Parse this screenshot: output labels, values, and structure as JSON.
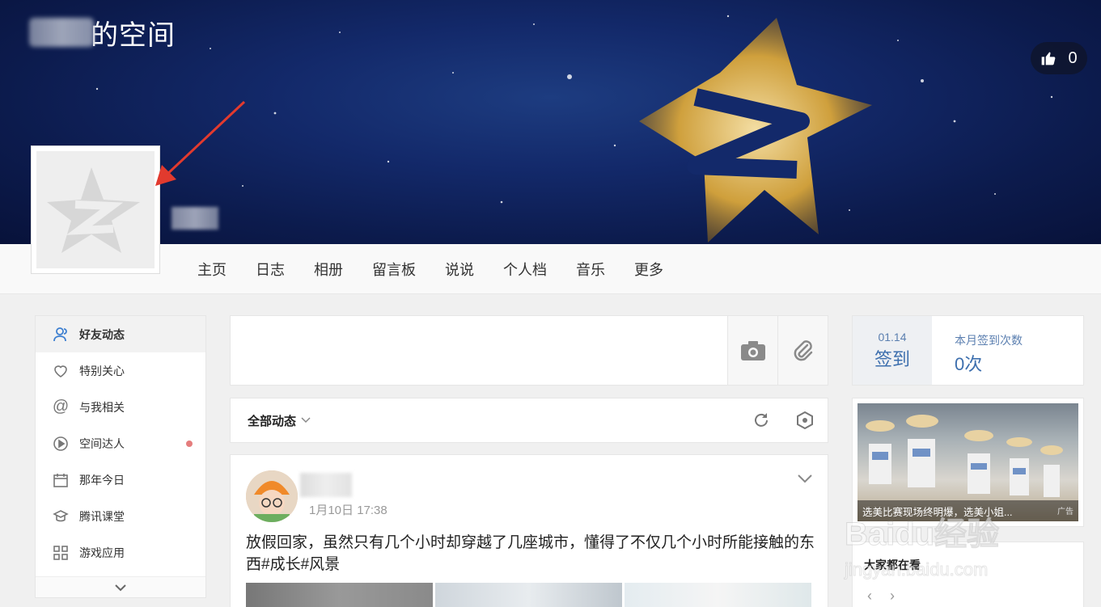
{
  "banner": {
    "space_title": "的空间",
    "likes": "0"
  },
  "nav": [
    "主页",
    "日志",
    "相册",
    "留言板",
    "说说",
    "个人档",
    "音乐",
    "更多"
  ],
  "sidebar": {
    "items": [
      {
        "label": "好友动态",
        "icon": "friends-icon",
        "active": true
      },
      {
        "label": "特别关心",
        "icon": "heart-icon"
      },
      {
        "label": "与我相关",
        "icon": "at-icon"
      },
      {
        "label": "空间达人",
        "icon": "play-icon",
        "badge": true
      },
      {
        "label": "那年今日",
        "icon": "calendar-icon"
      },
      {
        "label": "腾讯课堂",
        "icon": "classroom-icon"
      },
      {
        "label": "游戏应用",
        "icon": "apps-icon"
      }
    ]
  },
  "composer": {
    "placeholder": ""
  },
  "filter": {
    "label": "全部动态"
  },
  "feed": {
    "time": "1月10日 17:38",
    "text": "放假回家，虽然只有几个小时却穿越了几座城市，懂得了不仅几个小时所能接触的东西#成长#风景"
  },
  "checkin": {
    "date": "01.14",
    "button": "签到",
    "label": "本月签到次数",
    "count": "0次"
  },
  "ad": {
    "caption": "选美比赛现场终明爆，选美小姐...",
    "tag": "广告"
  },
  "watching": {
    "title": "大家都在看",
    "prev": "‹",
    "next": "›"
  },
  "watermark": {
    "brand": "Baidu经验",
    "url": "jingyan.baidu.com"
  },
  "colors": {
    "banner": "#0c1b4d",
    "accent": "#3d6fae",
    "badge": "#e57d7d"
  }
}
